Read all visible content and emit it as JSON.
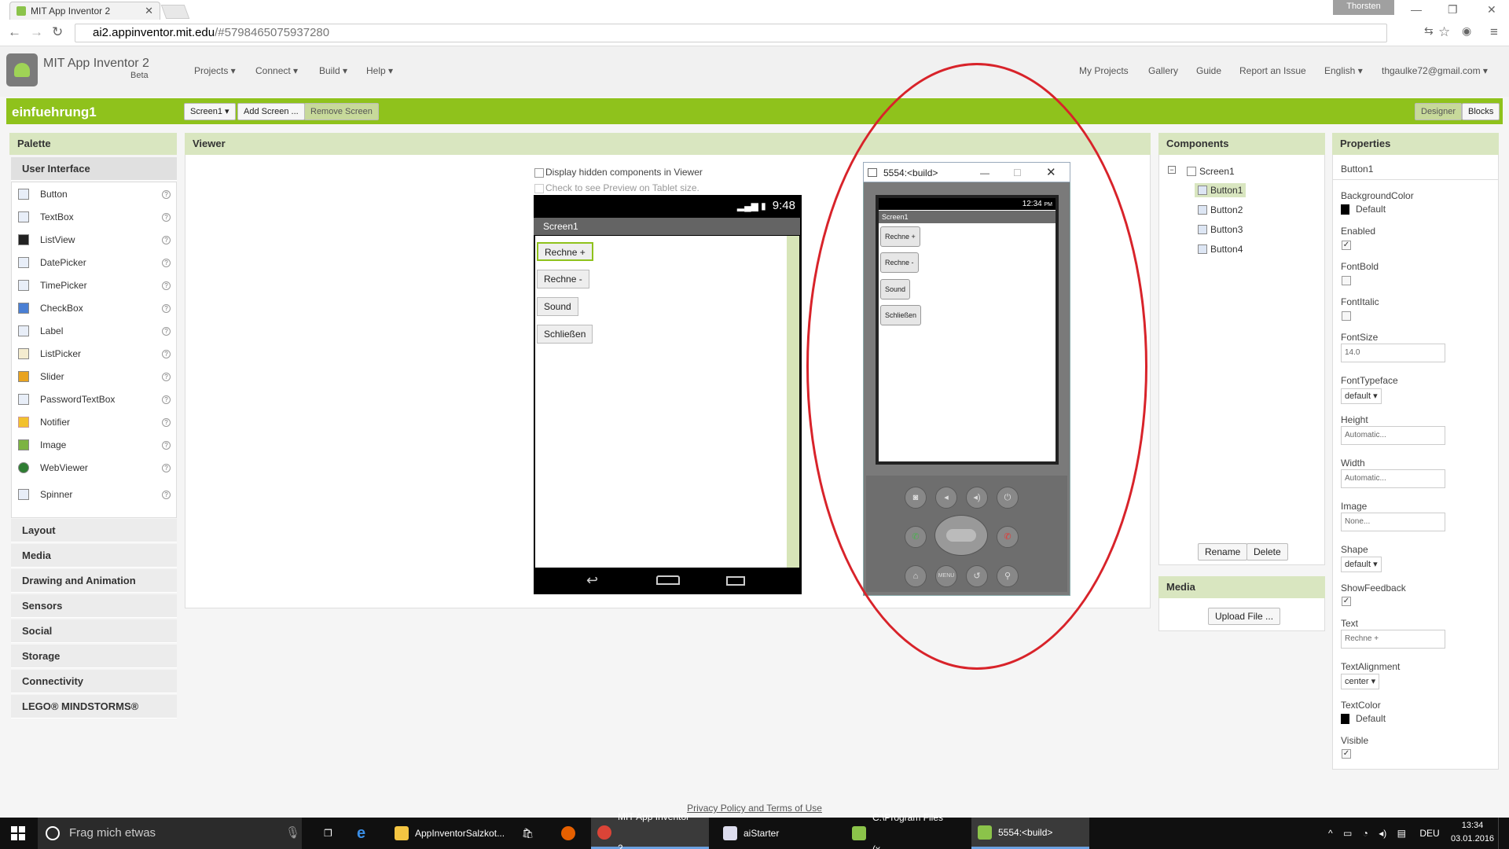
{
  "browser": {
    "tab_title": "MIT App Inventor 2",
    "user_badge": "Thorsten",
    "url_host": "ai2.appinventor.mit.edu",
    "url_rest": "/#5798465075937280"
  },
  "app": {
    "title": "MIT App Inventor 2",
    "beta": "Beta",
    "menus": [
      "Projects ▾",
      "Connect ▾",
      "Build ▾",
      "Help ▾"
    ],
    "right_links": [
      "My Projects",
      "Gallery",
      "Guide",
      "Report an Issue",
      "English ▾",
      "thgaulke72@gmail.com ▾"
    ]
  },
  "toolbar": {
    "project_name": "einfuehrung1",
    "screen_select": "Screen1 ▾",
    "add_screen": "Add Screen ...",
    "remove_screen": "Remove Screen",
    "designer": "Designer",
    "blocks": "Blocks"
  },
  "palette": {
    "title": "Palette",
    "open_category": "User Interface",
    "items": [
      "Button",
      "TextBox",
      "ListView",
      "DatePicker",
      "TimePicker",
      "CheckBox",
      "Label",
      "ListPicker",
      "Slider",
      "PasswordTextBox",
      "Notifier",
      "Image",
      "WebViewer",
      "Spinner"
    ],
    "categories": [
      "Layout",
      "Media",
      "Drawing and Animation",
      "Sensors",
      "Social",
      "Storage",
      "Connectivity",
      "LEGO® MINDSTORMS®"
    ]
  },
  "viewer": {
    "title": "Viewer",
    "opt_hidden": "Display hidden components in Viewer",
    "opt_tablet": "Check to see Preview on Tablet size.",
    "phone_time": "9:48",
    "screen_title": "Screen1",
    "buttons": [
      "Rechne +",
      "Rechne -",
      "Sound",
      "Schließen"
    ]
  },
  "emulator": {
    "window_title": "5554:<build>",
    "time": "12:34",
    "time_suffix": "PM",
    "screen_title": "Screen1",
    "buttons": [
      "Rechne +",
      "Rechne -",
      "Sound",
      "Schließen"
    ],
    "menu_key": "MENU"
  },
  "components": {
    "title": "Components",
    "root": "Screen1",
    "children": [
      "Button1",
      "Button2",
      "Button3",
      "Button4"
    ],
    "rename": "Rename",
    "delete": "Delete"
  },
  "media": {
    "title": "Media",
    "upload": "Upload File ..."
  },
  "properties": {
    "title": "Properties",
    "component": "Button1",
    "background_color_label": "BackgroundColor",
    "background_color_value": "Default",
    "enabled_label": "Enabled",
    "fontbold_label": "FontBold",
    "fontitalic_label": "FontItalic",
    "fontsize_label": "FontSize",
    "fontsize_value": "14.0",
    "fonttypeface_label": "FontTypeface",
    "fonttypeface_value": "default ▾",
    "height_label": "Height",
    "height_value": "Automatic...",
    "width_label": "Width",
    "width_value": "Automatic...",
    "image_label": "Image",
    "image_value": "None...",
    "shape_label": "Shape",
    "shape_value": "default ▾",
    "showfeedback_label": "ShowFeedback",
    "text_label": "Text",
    "text_value": "Rechne +",
    "textalignment_label": "TextAlignment",
    "textalignment_value": "center ▾",
    "textcolor_label": "TextColor",
    "textcolor_value": "Default",
    "visible_label": "Visible"
  },
  "footer": "Privacy Policy and Terms of Use",
  "taskbar": {
    "search_placeholder": "Frag mich etwas",
    "tasks": [
      "AppInventorSalzkot...",
      "MIT App Inventor 2...",
      "aiStarter",
      "C:\\Program Files (x...",
      "5554:<build>"
    ],
    "lang": "DEU",
    "time": "13:34",
    "date": "03.01.2016"
  },
  "colors": {
    "accent_green": "#8fc21c",
    "highlight_red": "#d8232a"
  }
}
